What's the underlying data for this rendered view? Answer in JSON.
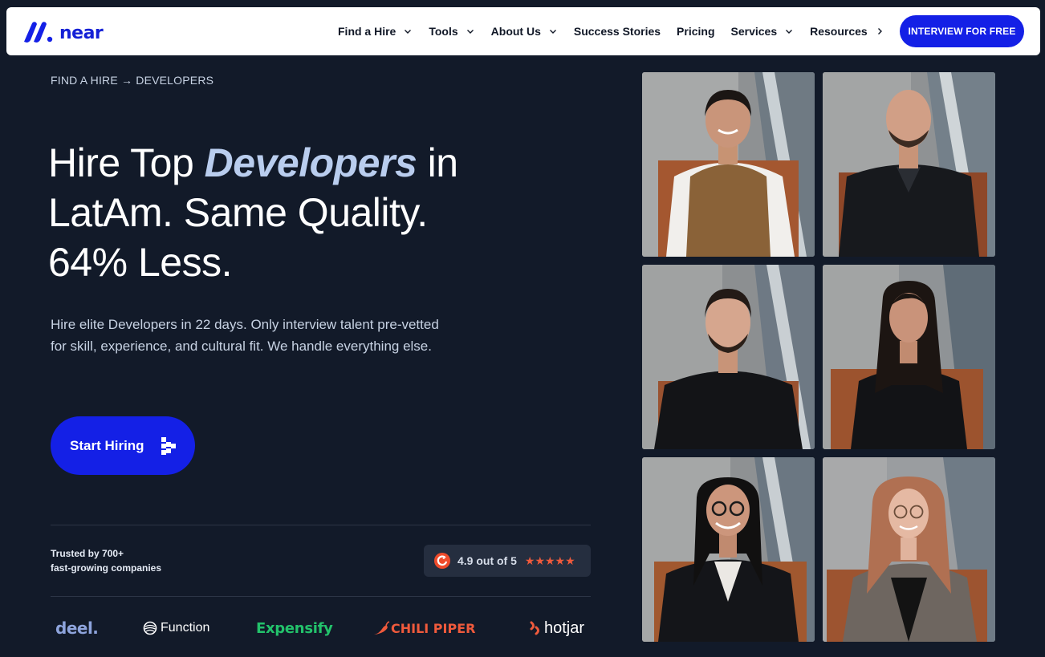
{
  "brand": {
    "name": "near",
    "color": "#1420e6"
  },
  "nav": {
    "items": [
      {
        "label": "Find a Hire",
        "chevron": "down"
      },
      {
        "label": "Tools",
        "chevron": "down"
      },
      {
        "label": "About Us",
        "chevron": "down"
      },
      {
        "label": "Success Stories",
        "chevron": ""
      },
      {
        "label": "Pricing",
        "chevron": ""
      },
      {
        "label": "Services",
        "chevron": "down"
      },
      {
        "label": "Resources",
        "chevron": "right"
      }
    ],
    "cta_label": "INTERVIEW FOR FREE"
  },
  "hero": {
    "breadcrumb": "FIND A HIRE → DEVELOPERS",
    "headline_pre": "Hire Top ",
    "headline_em": "Developers",
    "headline_line1_post": " in",
    "headline_line2": "LatAm. Same Quality.",
    "headline_line3": "64% Less.",
    "subtext": "Hire elite Developers in 22 days. Only interview talent pre-vetted for skill, experience, and cultural fit. We handle everything else.",
    "start_label": "Start Hiring"
  },
  "trust": {
    "line1": "Trusted by 700+",
    "line2": "fast-growing companies",
    "rating_text": "4.9 out of 5",
    "stars": "★★★★★",
    "star_color": "#ef5a3c"
  },
  "companies": [
    "deel.",
    "Function",
    "Expensify",
    "CHILI PIPER",
    "hotjar"
  ],
  "photos": [
    {
      "name": "woman-brown-vest"
    },
    {
      "name": "bald-man-black-suit"
    },
    {
      "name": "bearded-man-black-shirt"
    },
    {
      "name": "woman-black-top"
    },
    {
      "name": "woman-glasses-leather-jacket"
    },
    {
      "name": "woman-glasses-grey-blazer"
    }
  ]
}
